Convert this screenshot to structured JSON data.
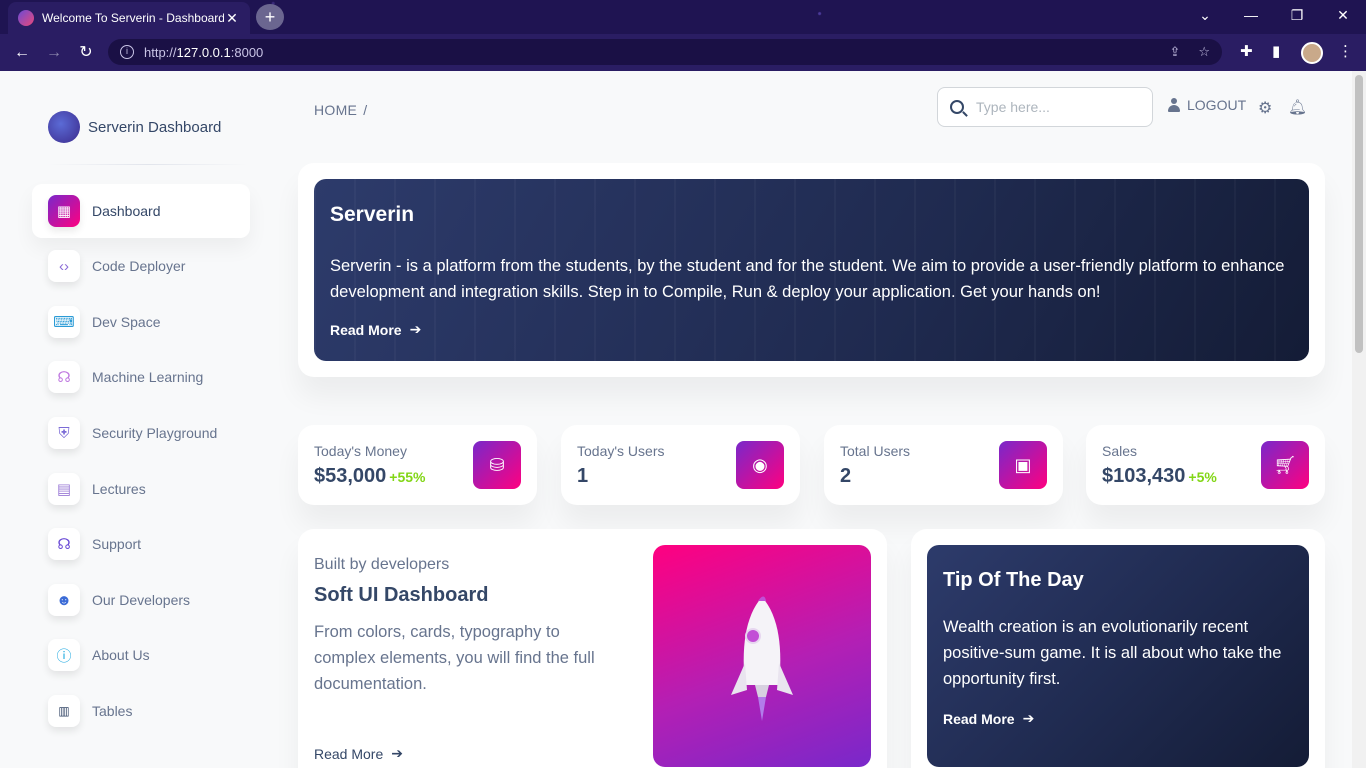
{
  "browser": {
    "tab_title": "Welcome To Serverin - Dashboard",
    "tab_close": "✕",
    "new_tab": "+",
    "url_prefix": "http://",
    "url_host": "127.0.0.1",
    "url_port": ":8000"
  },
  "sidebar": {
    "brand": "Serverin Dashboard",
    "items": [
      {
        "label": "Dashboard",
        "icon": "dashboard-icon",
        "active": true
      },
      {
        "label": "Code Deployer",
        "icon": "code-icon"
      },
      {
        "label": "Dev Space",
        "icon": "devspace-icon"
      },
      {
        "label": "Machine Learning",
        "icon": "brain-icon"
      },
      {
        "label": "Security Playground",
        "icon": "shield-icon"
      },
      {
        "label": "Lectures",
        "icon": "lectures-icon"
      },
      {
        "label": "Support",
        "icon": "headset-icon"
      },
      {
        "label": "Our Developers",
        "icon": "developer-icon"
      },
      {
        "label": "About Us",
        "icon": "info-icon"
      },
      {
        "label": "Tables",
        "icon": "table-icon"
      }
    ]
  },
  "navbar": {
    "breadcrumb": "HOME",
    "breadcrumb_sep": "/",
    "search_placeholder": "Type here...",
    "logout": "LOGOUT"
  },
  "hero": {
    "title": "Serverin",
    "text": "Serverin - is a platform from the students, by the student and for the student. We aim to provide a user-friendly platform to enhance development and integration skills. Step in to Compile, Run & deploy your application. Get your hands on!",
    "read_more": "Read More"
  },
  "stats": [
    {
      "title": "Today's Money",
      "value": "$53,000",
      "change": "+55%",
      "icon": "money-icon"
    },
    {
      "title": "Today's Users",
      "value": "1",
      "change": "",
      "icon": "globe-icon"
    },
    {
      "title": "Total Users",
      "value": "2",
      "change": "",
      "icon": "users-icon"
    },
    {
      "title": "Sales",
      "value": "$103,430",
      "change": "+5%",
      "icon": "cart-icon"
    }
  ],
  "soft_card": {
    "pre": "Built by developers",
    "title": "Soft UI Dashboard",
    "desc": "From colors, cards, typography to complex elements, you will find the full documentation.",
    "read_more": "Read More"
  },
  "tip": {
    "title": "Tip Of The Day",
    "text": "Wealth creation is an evolutionarily recent positive-sum game. It is all about who take the opportunity first.",
    "read_more": "Read More"
  },
  "colors": {
    "accent_gradient_start": "#7928ca",
    "accent_gradient_end": "#ff0080",
    "positive": "#82d616",
    "text_dark": "#344767",
    "text_muted": "#67748e"
  }
}
